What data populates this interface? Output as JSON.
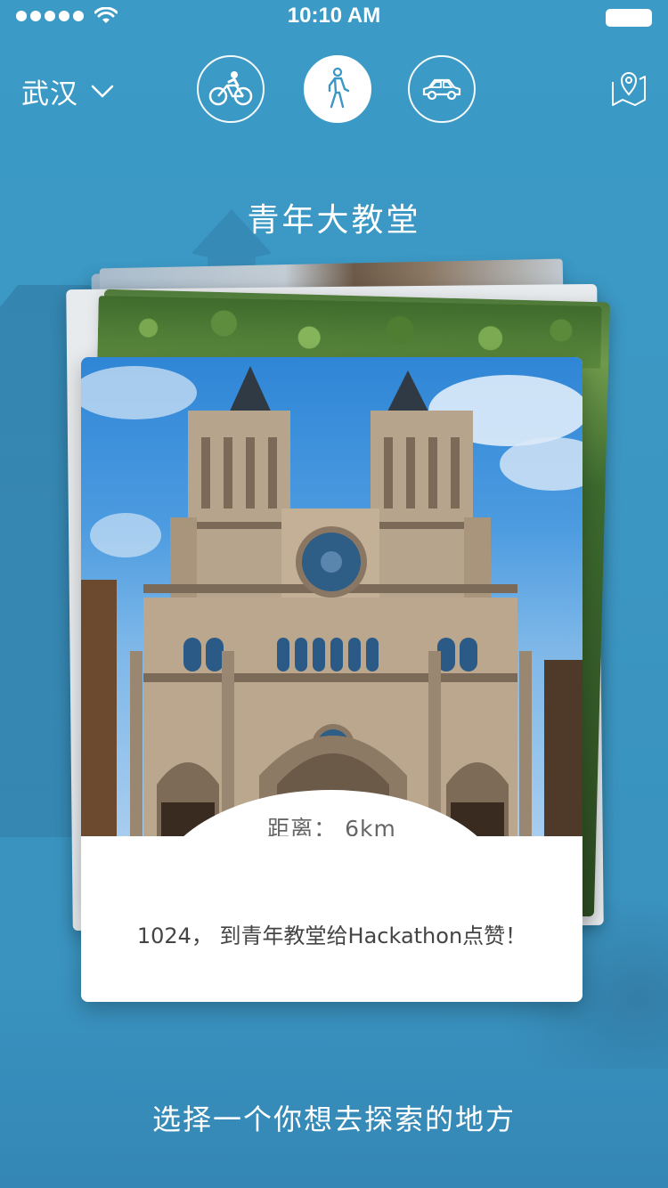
{
  "status_bar": {
    "signal_dots": 5,
    "time": "10:10 AM",
    "wifi_icon": "wifi-icon",
    "battery_icon": "battery-icon"
  },
  "header": {
    "city": "武汉",
    "city_dropdown_icon": "chevron-down-icon",
    "transport_modes": [
      {
        "name": "bike",
        "icon": "bicycle-icon",
        "selected": false
      },
      {
        "name": "walk",
        "icon": "walking-person-icon",
        "selected": true
      },
      {
        "name": "car",
        "icon": "car-icon",
        "selected": false
      }
    ],
    "map_icon": "map-pin-icon"
  },
  "place": {
    "title": "青年大教堂",
    "distance": "距离： 6km",
    "description": "1024， 到青年教堂给Hackathon点赞！"
  },
  "footer": {
    "prompt": "选择一个你想去探索的地方"
  },
  "colors": {
    "background": "#3b97c3",
    "card": "#ffffff",
    "text_primary": "#ffffff",
    "text_card": "#444444"
  }
}
